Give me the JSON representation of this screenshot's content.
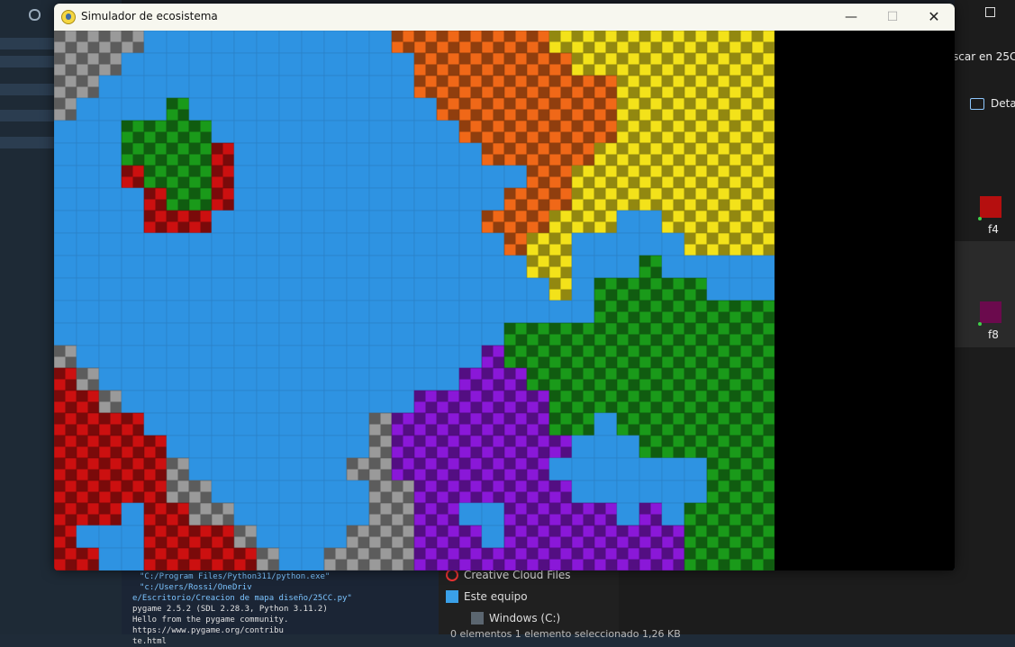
{
  "window": {
    "title": "Simulador de ecosistema",
    "minimize": "—",
    "maximize": "☐",
    "close": "✕"
  },
  "background": {
    "search_text": "scar en 25C",
    "details_label": "Deta",
    "files": [
      {
        "label": "f4",
        "color": "#b50f0f"
      },
      {
        "label": "f8",
        "color": "#6b0a4d"
      }
    ],
    "explorer_items": [
      "Creative Cloud Files",
      "Este equipo",
      "Windows (C:)"
    ],
    "status_text": "0 elementos  1 elemento seleccionado  1,26 KB",
    "terminal_lines": [
      "\"C:/Program Files/Python311/python.exe\" \"c:/Users/Rossi/OneDriv",
      "e/Escritorio/Creacion de mapa diseño/25CC.py\"",
      "pygame 2.5.2 (SDL 2.28.3, Python 3.11.2)",
      "Hello from the pygame community. https://www.pygame.org/contribu",
      "te.html"
    ]
  },
  "simulation": {
    "grid_cols": 32,
    "grid_rows": 24,
    "legend": {
      "W": "water",
      "R": "red",
      "O": "orange",
      "Y": "yellow",
      "G": "green",
      "P": "purple",
      "S": "stone"
    },
    "colors": {
      "W": "#2e93e2",
      "R": "#cc1010",
      "O": "#f06818",
      "Y": "#f3e21a",
      "G": "#1a9a1a",
      "P": "#8a18d8",
      "S": "#9a9a9a"
    },
    "map": [
      "SSSSWWWWWWWWWWWOOOOOOOYYYYYYYYYY",
      "SSSWWWWWWWWWWWWWOOOOOOOYYYYYYYYY",
      "SSWWWWWWWWWWWWWWOOOOOOOOOYYYYYYY",
      "SWWWWGWWWWWWWWWWWOOOOOOOOYYYYYYY",
      "WWWGGGGWWWWWWWWWWWOOOOOOOYYYYYYY",
      "WWWGGGGRWWWWWWWWWWWOOOOOYYYYYYYY",
      "WWWRGGGRWWWWWWWWWWWWWOOYYYYYYYYY",
      "WWWWRGGRWWWWWWWWWWWWOOOYYYYYYYYY",
      "WWWWRRRWWWWWWWWWWWWOOOYYYWWYYYYY",
      "WWWWWWWWWWWWWWWWWWWWOYYWWWWWYYYY",
      "WWWWWWWWWWWWWWWWWWWWWYYWWWGWWWWW",
      "WWWWWWWWWWWWWWWWWWWWWWYWGGGGGWWW",
      "WWWWWWWWWWWWWWWWWWWWWWWWGGGGGGGG",
      "WWWWWWWWWWWWWWWWWWWWGGGGGGGGGGGG",
      "SWWWWWWWWWWWWWWWWWWPGGGGGGGGGGGG",
      "RSWWWWWWWWWWWWWWWWPPPGGGGGGGGGGG",
      "RRSWWWWWWWWWWWWWPPPPPPGGGGGGGGGG",
      "RRRRWWWWWWWWWWSPPPPPPPGGWGGGGGGG",
      "RRRRRWWWWWWWWWSPPPPPPPPWWWGGGGGG",
      "RRRRRSWWWWWWWSSPPPPPPPWWWWWWWGGG",
      "RRRRRSSWWWWWWWSSPPPPPPPWWWWWWGGG",
      "RRRWRRSSWWWWWWSSPPWWPPPPPWPWGGGG",
      "RWWWRRRRSWWWWSSSPPPWPPPPPPPPGGGG",
      "RRWWRRRRRSWWSSSSPPPPPPPPPPPPGGGG"
    ]
  }
}
